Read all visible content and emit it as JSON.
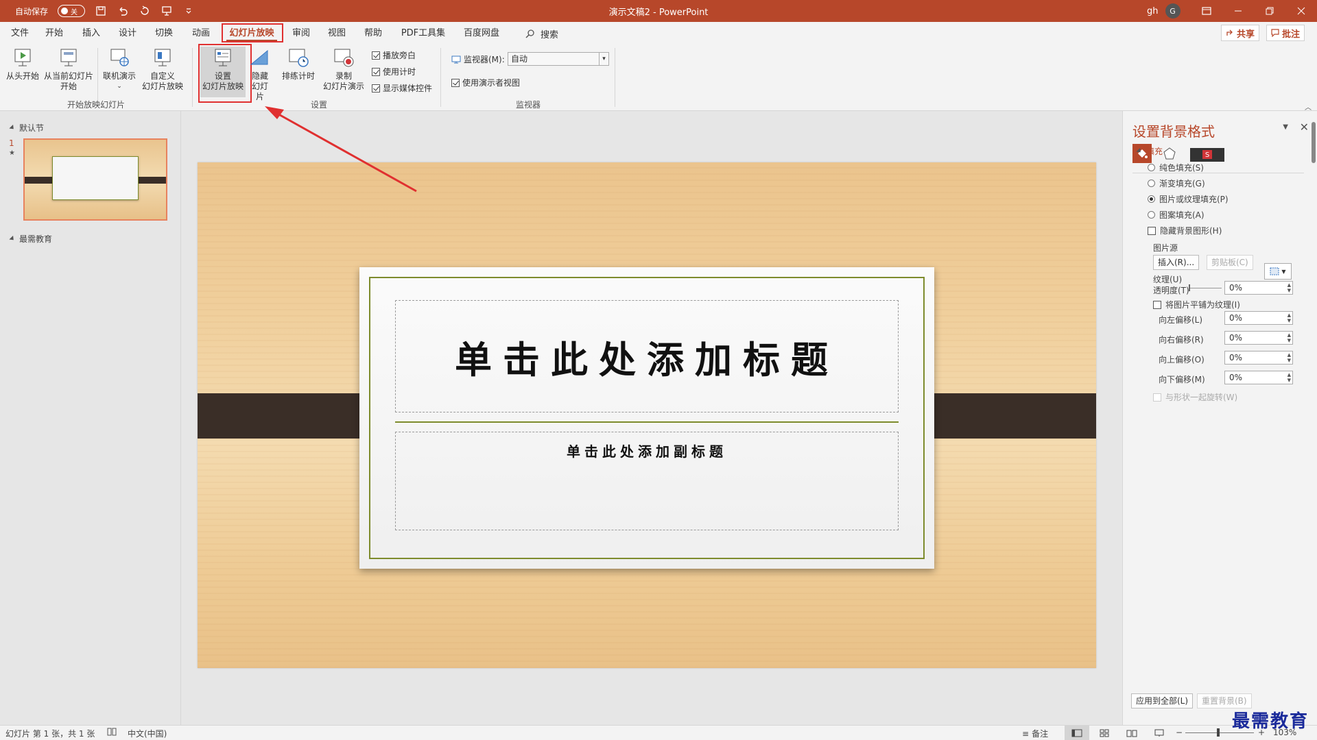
{
  "titlebar": {
    "autosave_label": "自动保存",
    "autosave_state": "关",
    "doc_title": "演示文稿2 - PowerPoint",
    "user_name": "gh",
    "avatar_letter": "G"
  },
  "tabs": [
    "文件",
    "开始",
    "插入",
    "设计",
    "切换",
    "动画",
    "幻灯片放映",
    "审阅",
    "视图",
    "帮助",
    "PDF工具集",
    "百度网盘"
  ],
  "active_tab": "幻灯片放映",
  "search_label": "搜索",
  "share_label": "共享",
  "comment_label": "批注",
  "ribbon": {
    "btn_from_start": "从头开始",
    "btn_from_current_1": "从当前幻灯片",
    "btn_from_current_2": "开始",
    "btn_online": "联机演示",
    "btn_custom_1": "自定义",
    "btn_custom_2": "幻灯片放映",
    "group_start": "开始放映幻灯片",
    "btn_setup_1": "设置",
    "btn_setup_2": "幻灯片放映",
    "btn_hide_1": "隐藏",
    "btn_hide_2": "幻灯片",
    "btn_rehearse": "排练计时",
    "btn_record_1": "录制",
    "btn_record_2": "幻灯片演示",
    "check_narration": "播放旁白",
    "check_timing": "使用计时",
    "check_media": "显示媒体控件",
    "group_setup": "设置",
    "monitor_label": "监视器(M):",
    "monitor_value": "自动",
    "check_presenter": "使用演示者视图",
    "group_monitor": "监视器"
  },
  "leftpane": {
    "section1": "默认节",
    "slide_number": "1",
    "section2": "最需教育"
  },
  "slide": {
    "title": "单击此处添加标题",
    "subtitle": "单击此处添加副标题"
  },
  "format_pane": {
    "title": "设置背景格式",
    "section_fill": "填充",
    "opt_solid": "纯色填充(S)",
    "opt_gradient": "渐变填充(G)",
    "opt_picture": "图片或纹理填充(P)",
    "opt_pattern": "图案填充(A)",
    "opt_hide_bg": "隐藏背景图形(H)",
    "picture_source": "图片源",
    "btn_insert": "插入(R)...",
    "btn_clipboard": "剪贴板(C)",
    "texture_label": "纹理(U)",
    "transparency_label": "透明度(T)",
    "transparency_value": "0%",
    "tile_label": "将图片平铺为纹理(I)",
    "offset_left_label": "向左偏移(L)",
    "offset_left": "0%",
    "offset_right_label": "向右偏移(R)",
    "offset_right": "0%",
    "offset_top_label": "向上偏移(O)",
    "offset_top": "0%",
    "offset_bottom_label": "向下偏移(M)",
    "offset_bottom": "0%",
    "rotate_label": "与形状一起旋转(W)",
    "btn_apply_all": "应用到全部(L)",
    "btn_reset": "重置背景(B)"
  },
  "statusbar": {
    "slide_info": "幻灯片 第 1 张，共 1 张",
    "language": "中文(中国)",
    "notes": "备注",
    "zoom": "103%"
  },
  "watermark": "最需教育",
  "colors": {
    "accent": "#b7472a",
    "highlight_box": "#e03030"
  }
}
